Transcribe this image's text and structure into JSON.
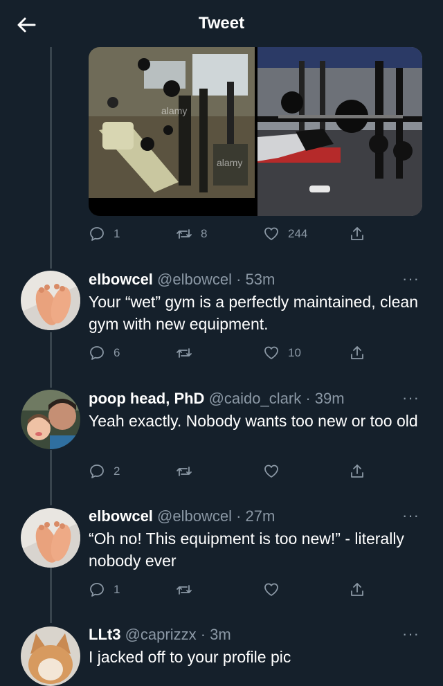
{
  "header": {
    "title": "Tweet"
  },
  "main_tweet": {
    "images": [
      "gym-photo-1",
      "gym-photo-2"
    ],
    "image_watermarks": [
      "alamy",
      "alamy"
    ],
    "actions": {
      "replies": "1",
      "retweets": "8",
      "likes": "244"
    }
  },
  "replies": [
    {
      "name": "elbowcel",
      "handle": "@elbowcel",
      "time": "· 53m",
      "text": "Your “wet” gym is a perfectly maintained, clean gym with new equipment.",
      "actions": {
        "replies": "6",
        "retweets": "",
        "likes": "10"
      }
    },
    {
      "name": "poop head, PhD",
      "handle": "@caido_clark",
      "time": "· 39m",
      "text": "Yeah exactly. Nobody wants too new or too old",
      "actions": {
        "replies": "2",
        "retweets": "",
        "likes": ""
      }
    },
    {
      "name": "elbowcel",
      "handle": "@elbowcel",
      "time": "· 27m",
      "text": "“Oh no! This equipment is too new!” - literally nobody ever",
      "actions": {
        "replies": "1",
        "retweets": "",
        "likes": ""
      }
    },
    {
      "name": "LLt3",
      "handle": "@caprizzx",
      "time": "· 3m",
      "text": "I jacked off to your profile pic"
    }
  ],
  "more_label": "···",
  "colors": {
    "background": "#15202b",
    "secondary_text": "#8b98a5",
    "thread_line": "#38444d"
  },
  "icons": [
    "back-arrow-icon",
    "reply-icon",
    "retweet-icon",
    "like-icon",
    "share-icon",
    "more-icon"
  ]
}
